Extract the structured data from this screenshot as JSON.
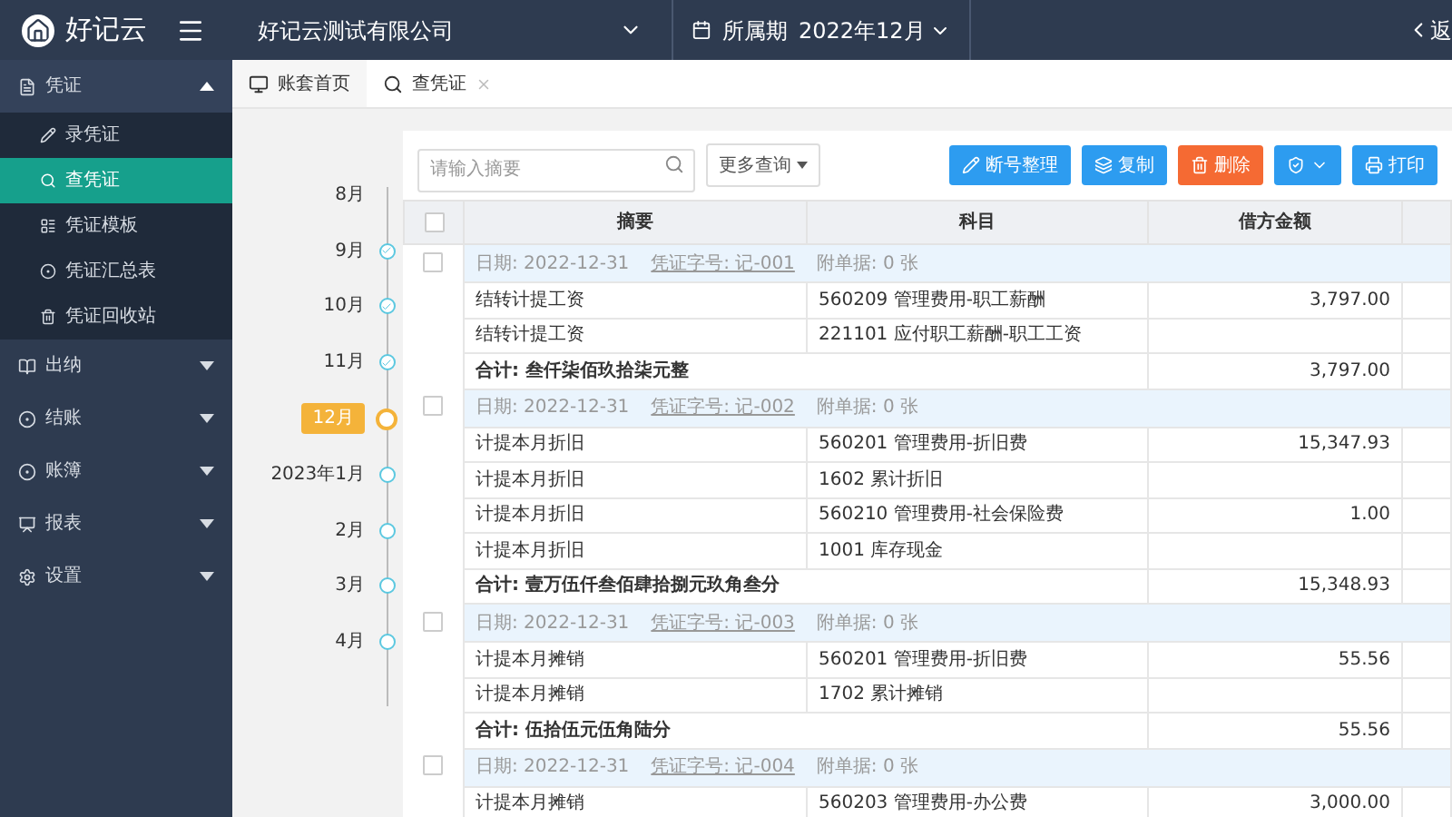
{
  "header": {
    "logo": "好记云",
    "company": "好记云测试有限公司",
    "period_label": "所属期",
    "period": "2022年12月",
    "back": "返"
  },
  "sidebar": {
    "items": [
      {
        "label": "凭证",
        "expanded": true,
        "children": [
          {
            "label": "录凭证",
            "selected": false
          },
          {
            "label": "查凭证",
            "selected": true
          },
          {
            "label": "凭证模板",
            "selected": false
          },
          {
            "label": "凭证汇总表",
            "selected": false
          },
          {
            "label": "凭证回收站",
            "selected": false
          }
        ]
      },
      {
        "label": "出纳",
        "expanded": false
      },
      {
        "label": "结账",
        "expanded": false
      },
      {
        "label": "账簿",
        "expanded": false
      },
      {
        "label": "报表",
        "expanded": false
      },
      {
        "label": "设置",
        "expanded": false
      }
    ]
  },
  "tabs": [
    {
      "label": "账套首页",
      "selected": false
    },
    {
      "label": "查凭证",
      "selected": true
    }
  ],
  "timeline": [
    {
      "label": "8月",
      "kind": "none",
      "selected": false
    },
    {
      "label": "9月",
      "kind": "closed",
      "selected": false
    },
    {
      "label": "10月",
      "kind": "closed",
      "selected": false
    },
    {
      "label": "11月",
      "kind": "closed",
      "selected": false
    },
    {
      "label": "12月",
      "kind": "open",
      "selected": true
    },
    {
      "label": "2023年1月",
      "kind": "open",
      "selected": false
    },
    {
      "label": "2月",
      "kind": "open",
      "selected": false
    },
    {
      "label": "3月",
      "kind": "open",
      "selected": false
    },
    {
      "label": "4月",
      "kind": "open",
      "selected": false
    }
  ],
  "toolbar": {
    "search": {
      "placeholder": "请输入摘要"
    },
    "more": "更多查询",
    "buttons": [
      {
        "label": "断号整理",
        "kind": "pen"
      },
      {
        "label": "复制",
        "kind": "copy"
      },
      {
        "label": "删除",
        "kind": "delete"
      },
      {
        "kind": "audit"
      },
      {
        "label": "打印",
        "kind": "print"
      }
    ]
  },
  "table": {
    "all_checked": false,
    "columns": [
      "摘要",
      "科目",
      "借方金额"
    ],
    "vouchers": [
      {
        "date": "日期: 2022-12-31",
        "number": "凭证字号: 记-001",
        "attachments": "附单据: 0 张",
        "checked": false,
        "entries": [
          {
            "summary": "结转计提工资",
            "account": "560209 管理费用-职工薪酬",
            "debit": "3,797.00"
          },
          {
            "summary": "结转计提工资",
            "account": "221101 应付职工薪酬-职工工资"
          }
        ],
        "total_label": "合计: 叁仟柒佰玖拾柒元整",
        "total": "3,797.00"
      },
      {
        "date": "日期: 2022-12-31",
        "number": "凭证字号: 记-002",
        "attachments": "附单据: 0 张",
        "checked": false,
        "entries": [
          {
            "summary": "计提本月折旧",
            "account": "560201 管理费用-折旧费",
            "debit": "15,347.93"
          },
          {
            "summary": "计提本月折旧",
            "account": "1602 累计折旧"
          },
          {
            "summary": "计提本月折旧",
            "account": "560210 管理费用-社会保险费",
            "debit": "1.00"
          },
          {
            "summary": "计提本月折旧",
            "account": "1001 库存现金"
          }
        ],
        "total_label": "合计: 壹万伍仟叁佰肆拾捌元玖角叁分",
        "total": "15,348.93"
      },
      {
        "date": "日期: 2022-12-31",
        "number": "凭证字号: 记-003",
        "attachments": "附单据: 0 张",
        "checked": false,
        "entries": [
          {
            "summary": "计提本月摊销",
            "account": "560201 管理费用-折旧费",
            "debit": "55.56"
          },
          {
            "summary": "计提本月摊销",
            "account": "1702 累计摊销"
          }
        ],
        "total_label": "合计: 伍拾伍元伍角陆分",
        "total": "55.56"
      },
      {
        "date": "日期: 2022-12-31",
        "number": "凭证字号: 记-004",
        "attachments": "附单据: 0 张",
        "checked": false,
        "entries": [
          {
            "summary": "计提本月摊销",
            "account": "560203 管理费用-办公费",
            "debit": "3,000.00"
          }
        ]
      }
    ]
  }
}
